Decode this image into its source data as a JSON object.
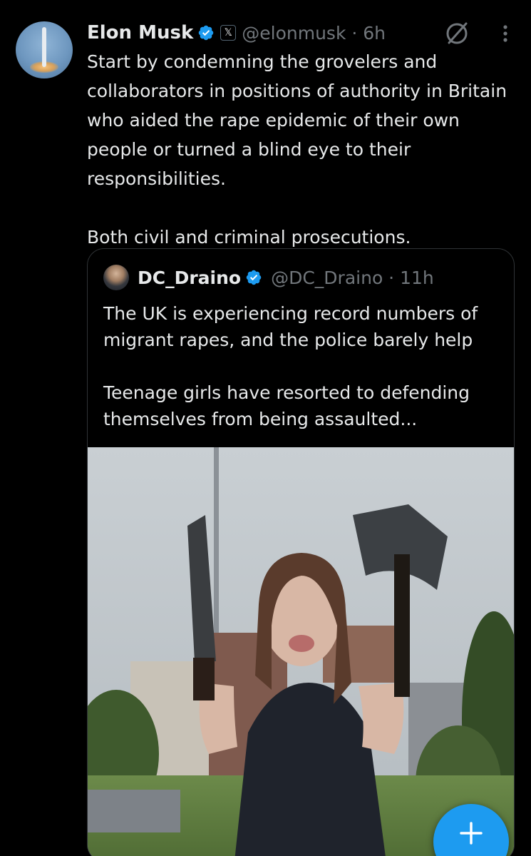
{
  "tweet": {
    "author_name": "Elon Musk",
    "x_badge": "𝕏",
    "handle_time": "@elonmusk · 6h",
    "text": "Start by condemning the grovelers and collaborators in positions of authority in Britain who aided the rape epidemic of their own people or turned a blind eye to their responsibilities.\n\nBoth civil and criminal prosecutions."
  },
  "quote": {
    "author_name": "DC_Draino",
    "handle_time": "@DC_Draino · 11h",
    "text": "The UK is experiencing record numbers of migrant rapes, and the police barely help\n\nTeenage girls have resorted to defending themselves from being assaulted..."
  },
  "icons": {
    "verified": "verified-badge-icon",
    "grok": "grok-icon",
    "more": "more-vertical-icon",
    "compose": "plus-icon"
  },
  "colors": {
    "background": "#000000",
    "text_primary": "#e7e9ea",
    "text_secondary": "#71767b",
    "accent": "#1d9bf0",
    "border": "#2f3336"
  }
}
